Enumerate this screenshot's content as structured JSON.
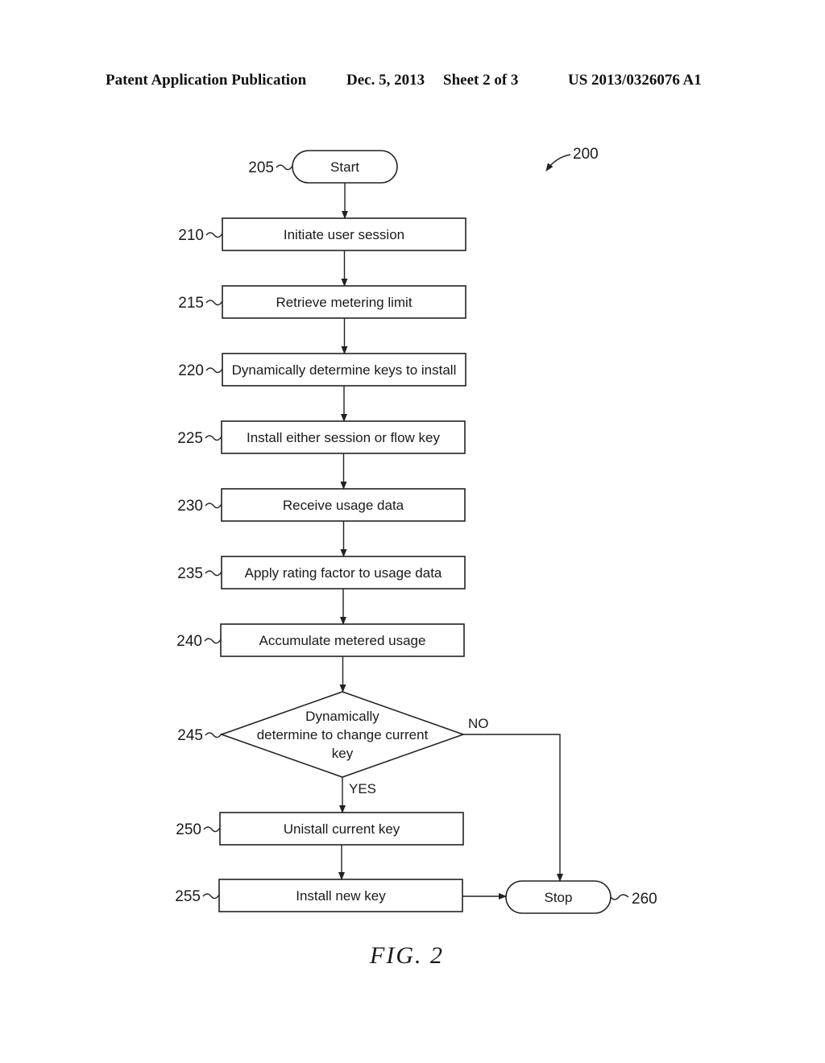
{
  "header": {
    "publication": "Patent Application Publication",
    "date": "Dec. 5, 2013",
    "sheet": "Sheet 2 of 3",
    "number": "US 2013/0326076 A1"
  },
  "diagram": {
    "figure_ref": "200",
    "figure_label": "FIG.  2",
    "nodes": [
      {
        "id": "205",
        "type": "terminal",
        "label": "Start"
      },
      {
        "id": "210",
        "type": "process",
        "label": "Initiate user session"
      },
      {
        "id": "215",
        "type": "process",
        "label": "Retrieve metering limit"
      },
      {
        "id": "220",
        "type": "process",
        "label": "Dynamically determine keys to install"
      },
      {
        "id": "225",
        "type": "process",
        "label": "Install either session or flow key"
      },
      {
        "id": "230",
        "type": "process",
        "label": "Receive usage data"
      },
      {
        "id": "235",
        "type": "process",
        "label": "Apply rating factor to usage data"
      },
      {
        "id": "240",
        "type": "process",
        "label": "Accumulate metered usage"
      },
      {
        "id": "245",
        "type": "decision",
        "label_lines": [
          "Dynamically",
          "determine to change current",
          "key"
        ]
      },
      {
        "id": "250",
        "type": "process",
        "label": "Unistall current key"
      },
      {
        "id": "255",
        "type": "process",
        "label": "Install new key"
      },
      {
        "id": "260",
        "type": "terminal",
        "label": "Stop"
      }
    ],
    "edges": [
      {
        "from": "205",
        "to": "210"
      },
      {
        "from": "210",
        "to": "215"
      },
      {
        "from": "215",
        "to": "220"
      },
      {
        "from": "220",
        "to": "225"
      },
      {
        "from": "225",
        "to": "230"
      },
      {
        "from": "230",
        "to": "235"
      },
      {
        "from": "235",
        "to": "240"
      },
      {
        "from": "240",
        "to": "245"
      },
      {
        "from": "245",
        "to": "250",
        "label": "YES"
      },
      {
        "from": "245",
        "to": "260",
        "label": "NO"
      },
      {
        "from": "250",
        "to": "255"
      },
      {
        "from": "255",
        "to": "260"
      }
    ]
  }
}
